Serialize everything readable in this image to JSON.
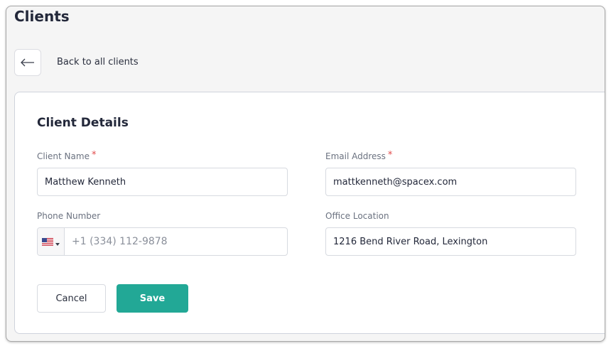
{
  "page": {
    "title": "Clients"
  },
  "nav": {
    "back_label": "Back to all clients"
  },
  "form": {
    "title": "Client Details",
    "client_name": {
      "label": "Client Name",
      "required_mark": "*",
      "value": "Matthew Kenneth"
    },
    "email": {
      "label": "Email Address",
      "required_mark": "*",
      "value": "mattkenneth@spacex.com"
    },
    "phone": {
      "label": "Phone Number",
      "country": "us-flag-icon",
      "placeholder": "+1 (334) 112-9878",
      "value": ""
    },
    "office": {
      "label": "Office Location",
      "value": "1216 Bend River Road, Lexington"
    },
    "cancel_label": "Cancel",
    "save_label": "Save"
  },
  "colors": {
    "accent": "#22a896",
    "required": "#e24b4b",
    "page_bg": "#f5f5f5",
    "border": "#d7dae0"
  }
}
